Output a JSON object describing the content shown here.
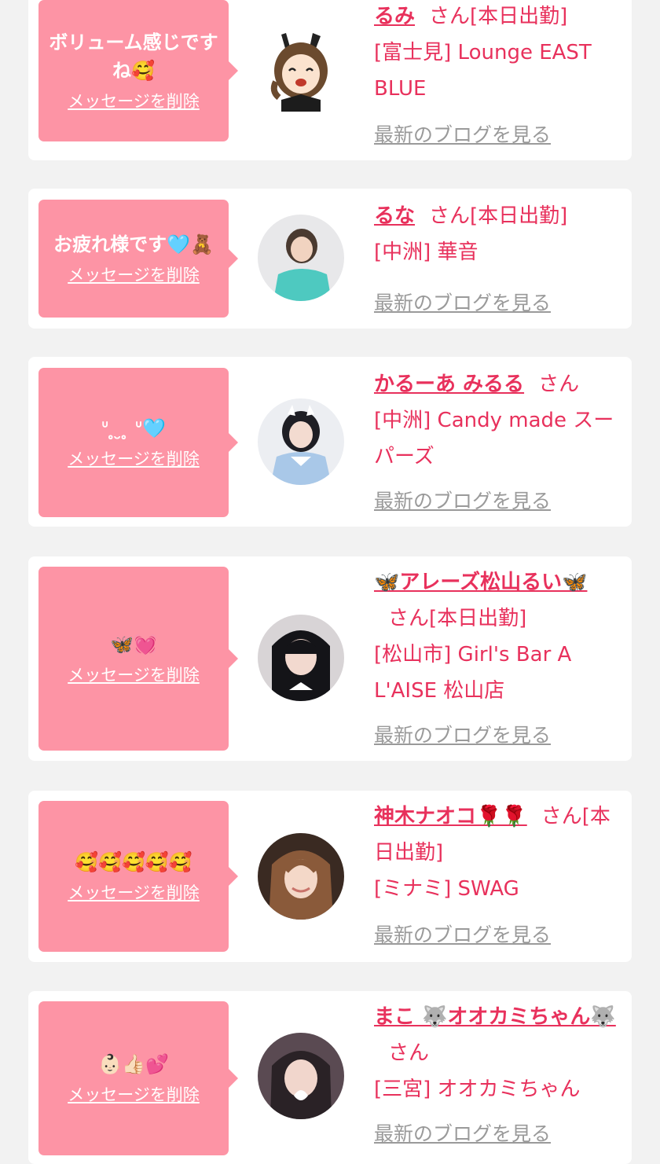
{
  "cards": [
    {
      "message": "ボリューム感じですね🥰",
      "delete_label": "メッセージを削除",
      "name": "るみ",
      "san": "さん",
      "status": "[本日出勤]",
      "shop": "[富士見] Lounge EAST BLUE",
      "blog": "最新のブログを見る"
    },
    {
      "message": "お疲れ様です🩵🧸",
      "delete_label": "メッセージを削除",
      "name": "るな",
      "san": "さん",
      "status": "[本日出勤]",
      "shop": "[中洲] 華音",
      "blog": "最新のブログを見る"
    },
    {
      "message": "ᐡ ̥ ̮ ̥ ᐡ🩵",
      "delete_label": "メッセージを削除",
      "name": "かるーあ みるる",
      "san": "さん",
      "status": "",
      "shop": "[中洲] Candy made スーパーズ",
      "blog": "最新のブログを見る"
    },
    {
      "message": "🦋💓",
      "delete_label": "メッセージを削除",
      "name": "🦋アレーズ松山るい🦋",
      "san": "さん",
      "status": "[本日出勤]",
      "shop": "[松山市] Girl's Bar A L'AISE 松山店",
      "blog": "最新のブログを見る"
    },
    {
      "message": "🥰🥰🥰🥰🥰",
      "delete_label": "メッセージを削除",
      "name": "神木ナオコ🌹🌹",
      "san": "さん",
      "status": "[本日出勤]",
      "shop": "[ミナミ] SWAG",
      "blog": "最新のブログを見る"
    },
    {
      "message": "👶🏻👍🏻💕",
      "delete_label": "メッセージを削除",
      "name": "まこ 🐺オオカミちゃん🐺",
      "san": "さん",
      "status": "",
      "shop": "[三宮] オオカミちゃん",
      "blog": "最新のブログを見る"
    }
  ],
  "colors": {
    "accent": "#e8315c",
    "bubble": "#fd94a5",
    "muted": "#9a9a9a",
    "background": "#f2f2f2"
  },
  "icons": [
    "avatar-cartoon-bunny-girl",
    "avatar-photo"
  ]
}
